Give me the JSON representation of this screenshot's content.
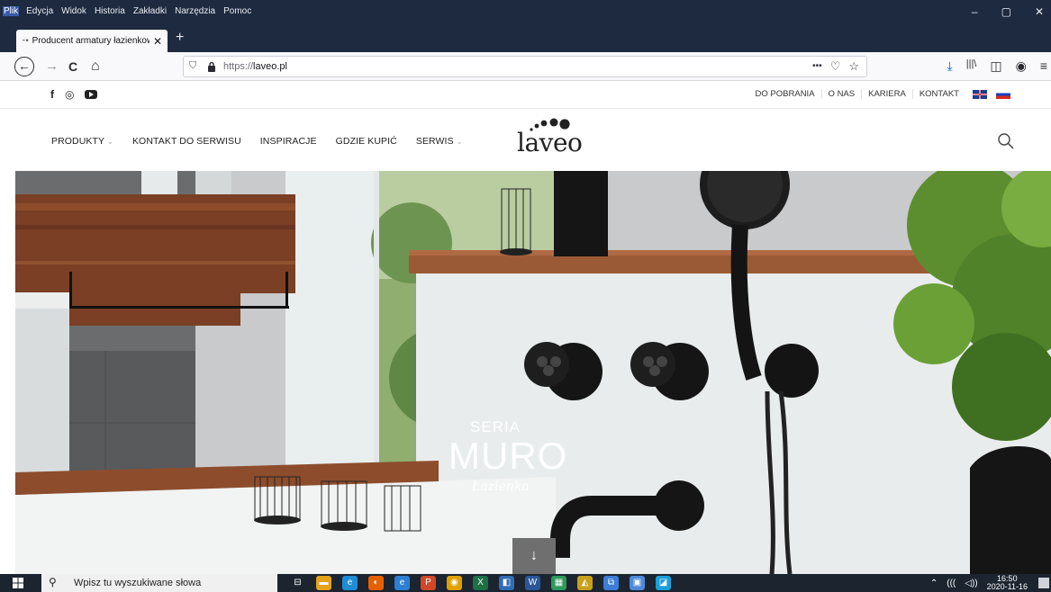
{
  "browser": {
    "menus": [
      "Plik",
      "Edycja",
      "Widok",
      "Historia",
      "Zakładki",
      "Narzędzia",
      "Pomoc"
    ],
    "window_controls": {
      "minimize": "–",
      "restore": "▢",
      "close": "✕"
    },
    "tab": {
      "title": "Producent armatury łazienkowej",
      "close": "✕"
    },
    "new_tab": "+",
    "nav": {
      "back": "←",
      "forward": "→",
      "reload": "C",
      "home": "⌂"
    },
    "url": {
      "protocol": "https://",
      "host": "laveo.pl"
    },
    "url_actions": {
      "more": "•••",
      "pocket": "♡",
      "bookmark": "☆"
    },
    "toolbar": {
      "download": "⤓",
      "library": "|||\\",
      "sidebar": "◫",
      "account": "◉",
      "menu": "≡"
    }
  },
  "site": {
    "social": {
      "facebook": "f",
      "instagram": "◎"
    },
    "top_links": [
      "DO POBRANIA",
      "O NAS",
      "KARIERA",
      "KONTAKT"
    ],
    "nav": [
      {
        "label": "PRODUKTY",
        "chevron": "⌄"
      },
      {
        "label": "KONTAKT DO SERWISU"
      },
      {
        "label": "INSPIRACJE"
      },
      {
        "label": "GDZIE KUPIĆ"
      },
      {
        "label": "SERWIS",
        "chevron": "⌄"
      }
    ],
    "logo": "laveo",
    "hero": {
      "seria": "SERIA",
      "title": "MURO",
      "subtitle": "Łazienka",
      "scroll": "↓"
    }
  },
  "taskbar": {
    "search_placeholder": "Wpisz tu wyszukiwane słowa",
    "search_icon": "⚲",
    "pinned": [
      {
        "icon": "task-view-icon",
        "glyph": "⊟",
        "color": "#1c2430"
      },
      {
        "icon": "file-explorer-icon",
        "glyph": "▬",
        "color": "#e3a21a"
      },
      {
        "icon": "edge-icon",
        "glyph": "e",
        "color": "#1f8dd6"
      },
      {
        "icon": "firefox-icon",
        "glyph": "◐",
        "color": "#e66000"
      },
      {
        "icon": "ie-icon",
        "glyph": "e",
        "color": "#2d7fd3"
      },
      {
        "icon": "powerpoint-icon",
        "glyph": "P",
        "color": "#d24726"
      },
      {
        "icon": "chrome-icon",
        "glyph": "◉",
        "color": "#e0a100"
      },
      {
        "icon": "excel-icon",
        "glyph": "X",
        "color": "#1d7044"
      },
      {
        "icon": "network-icon",
        "glyph": "◧",
        "color": "#2f6db5"
      },
      {
        "icon": "word-icon",
        "glyph": "W",
        "color": "#2b579a"
      },
      {
        "icon": "spreadsheet-icon",
        "glyph": "▦",
        "color": "#2e9a5b"
      },
      {
        "icon": "chart-app-icon",
        "glyph": "◭",
        "color": "#c8a11a"
      },
      {
        "icon": "remote-desktop-icon",
        "glyph": "⧉",
        "color": "#3b7dd8"
      },
      {
        "icon": "app-icon",
        "glyph": "▣",
        "color": "#4d8ad9"
      },
      {
        "icon": "photos-icon",
        "glyph": "◪",
        "color": "#1b9fd9"
      }
    ],
    "tray": {
      "chevron": "⌃",
      "network": "(((",
      "volume": "◁))"
    },
    "time": "16:50",
    "date": "2020-11-16"
  },
  "colors": {
    "chrome_dark": "#1e2a3f",
    "download_blue": "#0060df",
    "taskbar": "#1c2430"
  }
}
